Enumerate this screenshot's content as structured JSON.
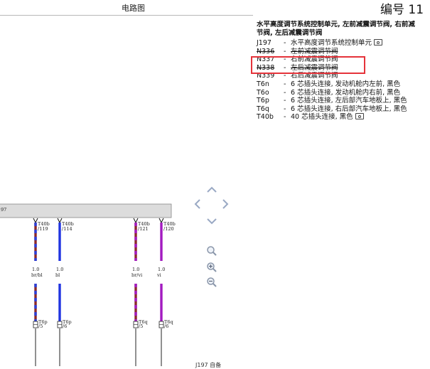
{
  "header": {
    "page_title": "电路图",
    "diagram_number": "编号 11"
  },
  "legend": {
    "heading": "水平高度调节系统控制单元, 左前减震调节阀, 右前减",
    "heading_line2": "节阀, 左后减震调节阀",
    "items": [
      {
        "code": "J197",
        "desc": "水平高度调节系统控制单元",
        "camera": true,
        "struck": false
      },
      {
        "code": "N336",
        "desc": "左前减震调节阀",
        "camera": false,
        "struck": true
      },
      {
        "code": "N337",
        "desc": "右前减震调节阀",
        "camera": false,
        "struck": false
      },
      {
        "code": "N338",
        "desc": "左后减震调节阀",
        "camera": false,
        "struck": true
      },
      {
        "code": "N339",
        "desc": "右后减震调节阀",
        "camera": false,
        "struck": false
      },
      {
        "code": "T6n",
        "desc": "6 芯插头连接, 发动机舱内左前, 黑色",
        "camera": false,
        "struck": false
      },
      {
        "code": "T6o",
        "desc": "6 芯插头连接, 发动机舱内右前, 黑色",
        "camera": false,
        "struck": false
      },
      {
        "code": "T6p",
        "desc": "6 芯插头连接, 左后部汽车地板上, 黑色",
        "camera": false,
        "struck": false
      },
      {
        "code": "T6q",
        "desc": "6 芯插头连接, 右后部汽车地板上, 黑色",
        "camera": false,
        "struck": false
      },
      {
        "code": "T40b",
        "desc": "40 芯插头连接, 黑色",
        "camera": true,
        "struck": false
      }
    ],
    "dash": "-"
  },
  "schematic": {
    "component_label": "97",
    "wires": [
      {
        "pin_top": "T40b",
        "pin_top_num": "/119",
        "gauge": "1.0",
        "color_code": "br/bl",
        "conn": "T6p",
        "conn_pin": "/5",
        "colors": [
          "#8b2a2a",
          "#2a3fd8"
        ]
      },
      {
        "pin_top": "T40b",
        "pin_top_num": "/114",
        "gauge": "1.0",
        "color_code": "bl",
        "conn": "T6p",
        "conn_pin": "/6",
        "colors": [
          "#1f33e0"
        ]
      },
      {
        "pin_top": "T40b",
        "pin_top_num": "/121",
        "gauge": "1.0",
        "color_code": "br/vi",
        "conn": "T6q",
        "conn_pin": "/5",
        "colors": [
          "#8b2a2a",
          "#a21ac0"
        ]
      },
      {
        "pin_top": "T40b",
        "pin_top_num": "/120",
        "gauge": "1.0",
        "color_code": "vi",
        "conn": "T6q",
        "conn_pin": "/6",
        "colors": [
          "#a21ac0"
        ]
      }
    ]
  },
  "controls": {
    "pan_up": "pan-up",
    "pan_left": "pan-left",
    "pan_right": "pan-right",
    "pan_down": "pan-down",
    "zoom_fit": "magnifier-icon",
    "zoom_in": "zoom-in-icon",
    "zoom_out": "zoom-out-icon"
  },
  "bottom_text": "J197 自备",
  "colors": {
    "highlight": "#e5333a",
    "bar": "#dcdcdc"
  }
}
